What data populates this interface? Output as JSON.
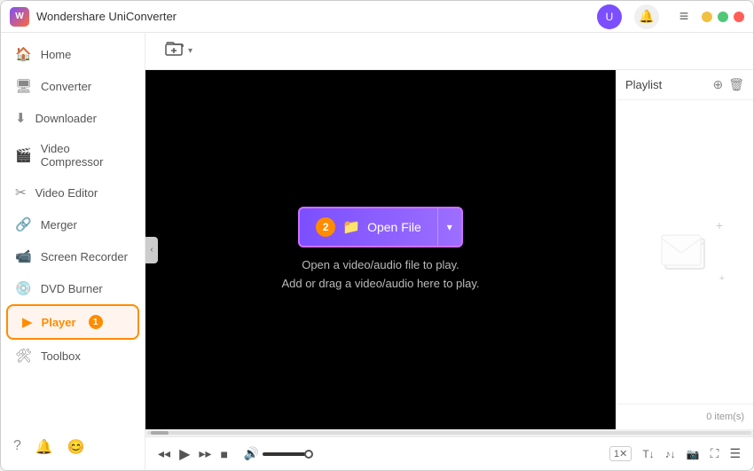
{
  "app": {
    "title": "Wondershare UniConverter",
    "logo_text": "W"
  },
  "titlebar": {
    "avatar_label": "U",
    "bell_icon": "🔔",
    "menu_icon": "≡",
    "minimize": "—",
    "maximize": "□",
    "close": "✕"
  },
  "sidebar": {
    "items": [
      {
        "id": "home",
        "label": "Home",
        "icon": "🏠",
        "active": false
      },
      {
        "id": "converter",
        "label": "Converter",
        "icon": "🖥",
        "active": false
      },
      {
        "id": "downloader",
        "label": "Downloader",
        "icon": "⬇",
        "active": false
      },
      {
        "id": "video-compressor",
        "label": "Video Compressor",
        "icon": "🎬",
        "active": false
      },
      {
        "id": "video-editor",
        "label": "Video Editor",
        "icon": "✂",
        "active": false
      },
      {
        "id": "merger",
        "label": "Merger",
        "icon": "🔗",
        "active": false
      },
      {
        "id": "screen-recorder",
        "label": "Screen Recorder",
        "icon": "📹",
        "active": false
      },
      {
        "id": "dvd-burner",
        "label": "DVD Burner",
        "icon": "💿",
        "active": false
      },
      {
        "id": "player",
        "label": "Player",
        "icon": "▶",
        "active": true,
        "badge": "1"
      },
      {
        "id": "toolbox",
        "label": "Toolbox",
        "icon": "🛠",
        "active": false
      }
    ],
    "footer_icons": [
      "?",
      "🔔",
      "😊"
    ]
  },
  "toolbar": {
    "add_file_icon": "📂+",
    "add_file_arrow": "▾"
  },
  "video_panel": {
    "open_file_badge": "2",
    "open_file_label": "Open File",
    "open_file_icon": "📁",
    "open_file_arrow": "▾",
    "hint_line1": "Open a video/audio file to play.",
    "hint_line2": "Add or drag a video/audio here to play.",
    "collapse_arrow": "‹"
  },
  "playlist": {
    "title": "Playlist",
    "add_icon": "⊕",
    "delete_icon": "🗑",
    "item_count": "0 item(s)"
  },
  "player_controls": {
    "prev": "◂◂",
    "play": "▶",
    "next": "▸▸",
    "stop": "■",
    "volume_icon": "🔊",
    "speed": "1✕",
    "subtitle": "T↓",
    "audio": "♪↓",
    "screenshot": "📷",
    "fullscreen": "⛶",
    "playlist_toggle": "☰"
  }
}
